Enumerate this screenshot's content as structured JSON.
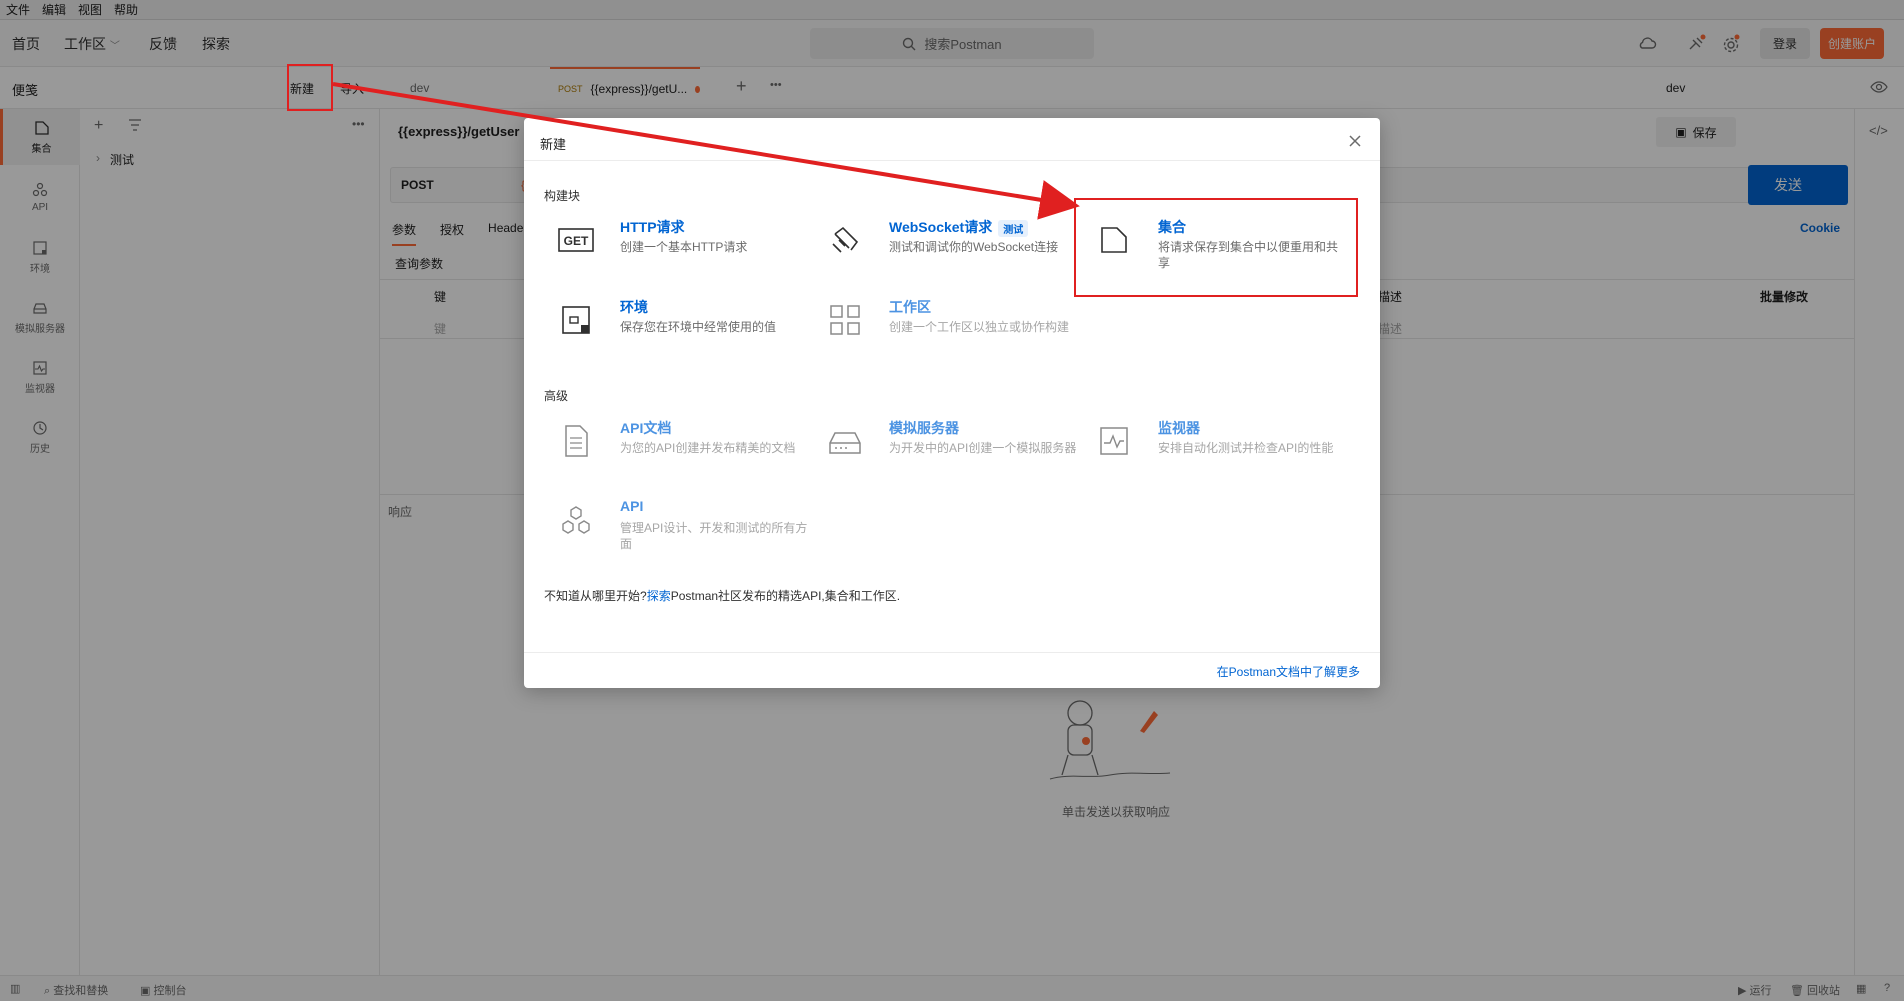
{
  "menubar": {
    "items": [
      "文件",
      "编辑",
      "视图",
      "帮助"
    ]
  },
  "header": {
    "nav": {
      "home": "首页",
      "workspace": "工作区",
      "feedback": "反馈",
      "explore": "探索"
    },
    "search_placeholder": "搜索Postman",
    "signin": "登录",
    "signup": "创建账户"
  },
  "sidebar": {
    "title": "便笺",
    "new_button": "新建",
    "import_button": "导入",
    "rail": [
      {
        "label": "集合",
        "icon": "collection-icon"
      },
      {
        "label": "API",
        "icon": "api-icon"
      },
      {
        "label": "环境",
        "icon": "environment-icon"
      },
      {
        "label": "模拟服务器",
        "icon": "mock-server-icon"
      },
      {
        "label": "监视器",
        "icon": "monitor-icon"
      },
      {
        "label": "历史",
        "icon": "history-icon"
      }
    ],
    "tree": [
      {
        "label": "测试"
      }
    ]
  },
  "tabs": {
    "env_tab": "dev",
    "request_tab": {
      "method": "POST",
      "label": "{{express}}/getU..."
    },
    "env_selector": "dev"
  },
  "request": {
    "title": "{{express}}/getUser",
    "save": "保存",
    "method": "POST",
    "url_prefix": "{{",
    "send": "发送",
    "subtabs": [
      "参数",
      "授权",
      "Heade"
    ],
    "cookie": "Cookie",
    "query_label": "查询参数",
    "table_headers": {
      "key": "键",
      "description": "描述",
      "bulk_edit": "批量修改"
    },
    "placeholder_row": {
      "key": "键",
      "description": "描述"
    },
    "response_label": "响应",
    "empty_response": "单击发送以获取响应"
  },
  "statusbar": {
    "find_replace": "查找和替换",
    "console": "控制台",
    "runner": "运行",
    "trash": "回收站"
  },
  "modal": {
    "title": "新建",
    "section_building_blocks": "构建块",
    "section_advanced": "高级",
    "blocks": [
      {
        "title": "HTTP请求",
        "desc": "创建一个基本HTTP请求",
        "icon": "get-request-icon",
        "icon_text": "GET"
      },
      {
        "title": "WebSocket请求",
        "badge": "测试",
        "desc": "测试和调试你的WebSocket连接",
        "icon": "websocket-icon"
      },
      {
        "title": "集合",
        "desc": "将请求保存到集合中以便重用和共享",
        "icon": "collection-icon"
      },
      {
        "title": "环境",
        "desc": "保存您在环境中经常使用的值",
        "icon": "environment-icon"
      },
      {
        "title": "工作区",
        "desc": "创建一个工作区以独立或协作构建",
        "icon": "workspace-icon"
      }
    ],
    "advanced": [
      {
        "title": "API文档",
        "desc": "为您的API创建并发布精美的文档",
        "icon": "api-doc-icon"
      },
      {
        "title": "模拟服务器",
        "desc": "为开发中的API创建一个模拟服务器",
        "icon": "mock-server-icon"
      },
      {
        "title": "监视器",
        "desc": "安排自动化测试并检查API的性能",
        "icon": "monitor-icon"
      },
      {
        "title": "API",
        "desc": "管理API设计、开发和测试的所有方面",
        "icon": "api-icon"
      }
    ],
    "explore_text_before": "不知道从哪里开始?",
    "explore_link": "探索",
    "explore_text_after": "Postman社区发布的精选API,集合和工作区.",
    "learn_more": "在Postman文档中了解更多"
  },
  "colors": {
    "accent": "#ff6c37",
    "link": "#0265d2",
    "annotation": "#e02020"
  }
}
